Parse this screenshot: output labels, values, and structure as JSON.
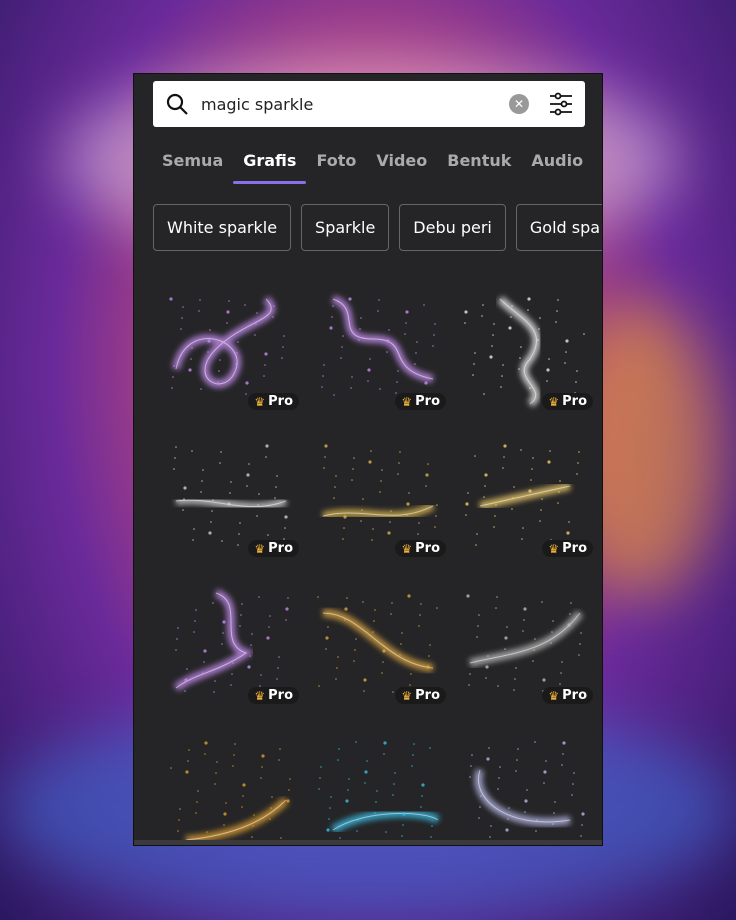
{
  "search": {
    "value": "magic sparkle",
    "clear_icon": "close-circle-icon",
    "filter_icon": "sliders-icon"
  },
  "tabs": [
    {
      "label": "Semua"
    },
    {
      "label": "Grafis",
      "active": true
    },
    {
      "label": "Foto"
    },
    {
      "label": "Video"
    },
    {
      "label": "Bentuk"
    },
    {
      "label": "Audio"
    }
  ],
  "chips": [
    "White sparkle",
    "Sparkle",
    "Debu peri",
    "Gold spa"
  ],
  "badge": "Pro",
  "accent": "#8b6ee8",
  "results": [
    {
      "kind": "purple-swirl",
      "pro": true
    },
    {
      "kind": "purple-ribbon",
      "pro": true
    },
    {
      "kind": "white-sparkle-trail",
      "pro": true
    },
    {
      "kind": "white-dust",
      "pro": true
    },
    {
      "kind": "gold-dust",
      "pro": true
    },
    {
      "kind": "gold-stars",
      "pro": true
    },
    {
      "kind": "purple-curl",
      "pro": true
    },
    {
      "kind": "gold-wave",
      "pro": true
    },
    {
      "kind": "silver-dust-arc",
      "pro": true
    },
    {
      "kind": "gold-trail",
      "pro": false
    },
    {
      "kind": "blue-ring",
      "pro": false
    },
    {
      "kind": "lavender-smoke",
      "pro": false
    }
  ]
}
